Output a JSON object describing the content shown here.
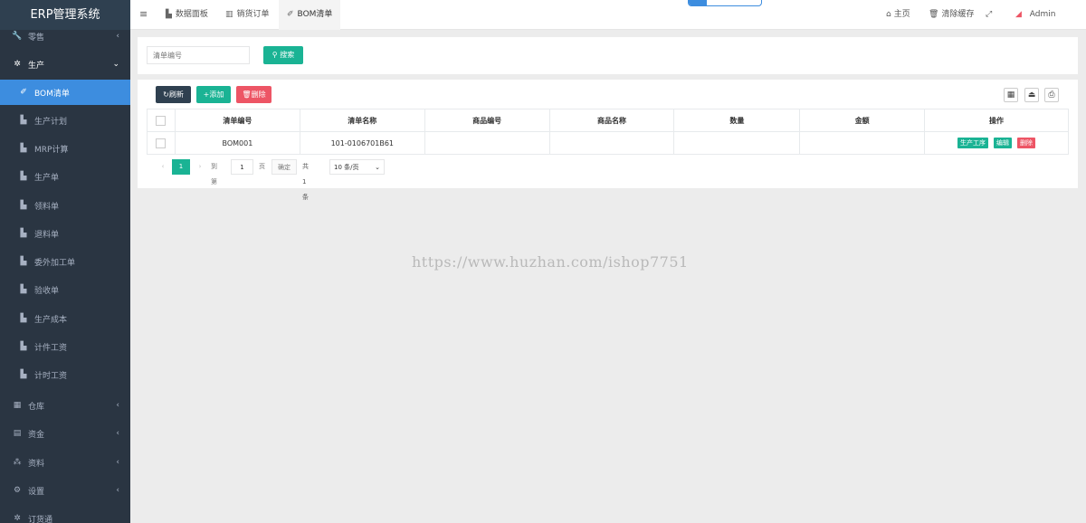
{
  "app": {
    "title": "ERP管理系统"
  },
  "sidebar": {
    "items": [
      {
        "label": "零售",
        "icon": "wrench-icon",
        "glyph": "🔧",
        "arrow": "‹",
        "level": "top",
        "state": ""
      },
      {
        "label": "生产",
        "icon": "cogs-icon",
        "glyph": "✲",
        "arrow": "⌄",
        "level": "top",
        "state": "open"
      },
      {
        "label": "BOM清单",
        "icon": "eraser-icon",
        "glyph": "✐",
        "arrow": "",
        "level": "sub",
        "state": "active"
      },
      {
        "label": "生产计划",
        "icon": "area-chart-icon",
        "glyph": "▙",
        "arrow": "",
        "level": "sub",
        "state": ""
      },
      {
        "label": "MRP计算",
        "icon": "area-chart-icon",
        "glyph": "▙",
        "arrow": "",
        "level": "sub",
        "state": ""
      },
      {
        "label": "生产单",
        "icon": "area-chart-icon",
        "glyph": "▙",
        "arrow": "",
        "level": "sub",
        "state": ""
      },
      {
        "label": "领料单",
        "icon": "area-chart-icon",
        "glyph": "▙",
        "arrow": "",
        "level": "sub",
        "state": ""
      },
      {
        "label": "退料单",
        "icon": "area-chart-icon",
        "glyph": "▙",
        "arrow": "",
        "level": "sub",
        "state": ""
      },
      {
        "label": "委外加工单",
        "icon": "area-chart-icon",
        "glyph": "▙",
        "arrow": "",
        "level": "sub",
        "state": ""
      },
      {
        "label": "验收单",
        "icon": "area-chart-icon",
        "glyph": "▙",
        "arrow": "",
        "level": "sub",
        "state": ""
      },
      {
        "label": "生产成本",
        "icon": "area-chart-icon",
        "glyph": "▙",
        "arrow": "",
        "level": "sub",
        "state": ""
      },
      {
        "label": "计件工资",
        "icon": "area-chart-icon",
        "glyph": "▙",
        "arrow": "",
        "level": "sub",
        "state": ""
      },
      {
        "label": "计时工资",
        "icon": "area-chart-icon",
        "glyph": "▙",
        "arrow": "",
        "level": "sub",
        "state": ""
      },
      {
        "label": "仓库",
        "icon": "building-icon",
        "glyph": "▦",
        "arrow": "‹",
        "level": "top",
        "state": ""
      },
      {
        "label": "资金",
        "icon": "database-icon",
        "glyph": "▤",
        "arrow": "‹",
        "level": "top",
        "state": ""
      },
      {
        "label": "资料",
        "icon": "sitemap-icon",
        "glyph": "⁂",
        "arrow": "‹",
        "level": "top",
        "state": ""
      },
      {
        "label": "设置",
        "icon": "gears-icon",
        "glyph": "⚙",
        "arrow": "‹",
        "level": "top",
        "state": ""
      },
      {
        "label": "订货通",
        "icon": "cubes-icon",
        "glyph": "✲",
        "arrow": "",
        "level": "top",
        "state": ""
      }
    ]
  },
  "topbar": {
    "menu_glyph": "≡",
    "tabs": [
      {
        "label": "数据面板",
        "icon": "area-chart-icon",
        "glyph": "▙",
        "active": false
      },
      {
        "label": "销货订单",
        "icon": "bar-chart-icon",
        "glyph": "▥",
        "active": false
      },
      {
        "label": "BOM清单",
        "icon": "eraser-icon",
        "glyph": "✐",
        "active": true
      }
    ],
    "home": {
      "label": "主页",
      "glyph": "⌂"
    },
    "clear_cache": {
      "label": "清除缓存",
      "glyph": "🗑"
    },
    "fullscreen_glyph": "⤢",
    "user": {
      "label": "Admin",
      "glyph": "◢"
    }
  },
  "search": {
    "placeholder": "清单编号",
    "button_label": "搜索",
    "button_glyph": "⚲"
  },
  "toolbar": {
    "refresh": {
      "label": "刷新",
      "glyph": "↻"
    },
    "add": {
      "label": "添加",
      "glyph": "+"
    },
    "delete": {
      "label": "删除",
      "glyph": "🗑"
    },
    "columns_glyph": "▦",
    "export_glyph": "⏏",
    "print_glyph": "⎙"
  },
  "table": {
    "headers": [
      "清单编号",
      "清单名称",
      "商品编号",
      "商品名称",
      "数量",
      "金额",
      "操作"
    ],
    "rows": [
      {
        "code": "BOM001",
        "name": "101-0106701B61",
        "item_code": "",
        "item_name": "",
        "qty": "",
        "amount": ""
      }
    ],
    "row_actions": {
      "process": "生产工序",
      "edit": "编辑",
      "delete": "删除"
    }
  },
  "pager": {
    "prev": "‹",
    "current": "1",
    "next": "›",
    "goto_label": "到第",
    "page_input": "1",
    "page_unit": "页",
    "confirm": "确定",
    "total": "共 1 条",
    "page_size": "10 条/页",
    "caret": "⌄"
  },
  "watermark": "https://www.huzhan.com/ishop7751",
  "colors": {
    "sidebar": "#2a3542",
    "active_item": "#3d8ddf",
    "primary": "#1ab394",
    "danger": "#ed5565",
    "dark_button": "#2f4050"
  }
}
